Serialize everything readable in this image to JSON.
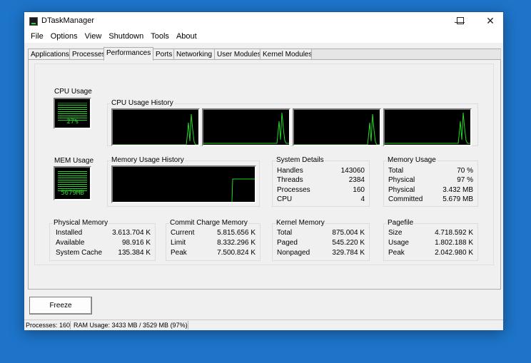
{
  "window": {
    "title": "DTaskManager",
    "min": "—",
    "max": "☐",
    "close": "✕"
  },
  "menu": [
    "File",
    "Options",
    "View",
    "Shutdown",
    "Tools",
    "About"
  ],
  "tabs": [
    "Applications",
    "Processes",
    "Performances",
    "Ports",
    "Networking",
    "User Modules",
    "Kernel Modules"
  ],
  "active_tab": "Performances",
  "cpu_usage": {
    "label": "CPU Usage",
    "value": "27%",
    "percent": 27
  },
  "cpu_history": {
    "label": "CPU Usage History",
    "cores": 4
  },
  "mem_usage": {
    "label": "MEM Usage",
    "value": "5679MB",
    "percent": 97
  },
  "mem_history": {
    "label": "Memory Usage History"
  },
  "system_details": {
    "title": "System Details",
    "rows": [
      {
        "k": "Handles",
        "v": "143060"
      },
      {
        "k": "Threads",
        "v": "2384"
      },
      {
        "k": "Processes",
        "v": "160"
      },
      {
        "k": "CPU",
        "v": "4"
      }
    ]
  },
  "memory_usage": {
    "title": "Memory Usage",
    "rows": [
      {
        "k": "Total",
        "v": "70 %"
      },
      {
        "k": "Physical",
        "v": "97 %"
      },
      {
        "k": "Physical",
        "v": "3.432 MB"
      },
      {
        "k": "Committed",
        "v": "5.679 MB"
      }
    ]
  },
  "physical_memory": {
    "title": "Physical Memory",
    "rows": [
      {
        "k": "Installed",
        "v": "3.613.704 K"
      },
      {
        "k": "Available",
        "v": "98.916 K"
      },
      {
        "k": "System Cache",
        "v": "135.384 K"
      }
    ]
  },
  "commit_charge": {
    "title": "Commit Charge Memory",
    "rows": [
      {
        "k": "Current",
        "v": "5.815.656 K"
      },
      {
        "k": "Limit",
        "v": "8.332.296 K"
      },
      {
        "k": "Peak",
        "v": "7.500.824 K"
      }
    ]
  },
  "kernel_memory": {
    "title": "Kernel Memory",
    "rows": [
      {
        "k": "Total",
        "v": "875.004 K"
      },
      {
        "k": "Paged",
        "v": "545.220 K"
      },
      {
        "k": "Nonpaged",
        "v": "329.784 K"
      }
    ]
  },
  "pagefile": {
    "title": "Pagefile",
    "rows": [
      {
        "k": "Size",
        "v": "4.718.592 K"
      },
      {
        "k": "Usage",
        "v": "1.802.188 K"
      },
      {
        "k": "Peak",
        "v": "2.042.980 K"
      }
    ]
  },
  "freeze_label": "Freeze",
  "status": {
    "processes": "Processes: 160",
    "ram": "RAM Usage:  3433 MB / 3529 MB (97%)"
  },
  "colors": {
    "desktop": "#1d74c9",
    "graph_line": "#22d922",
    "graph_bg": "#000000"
  }
}
